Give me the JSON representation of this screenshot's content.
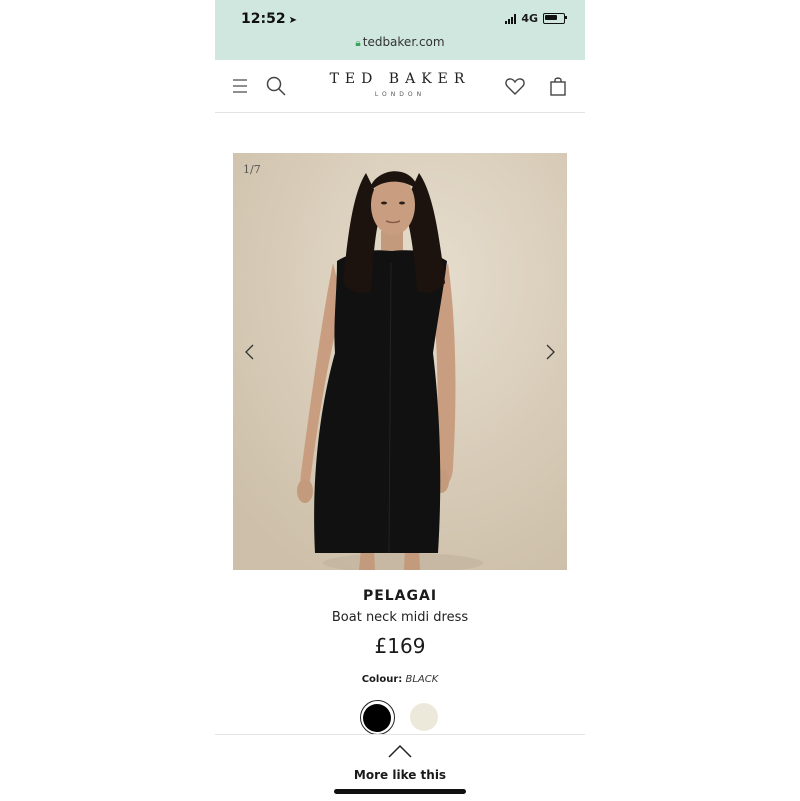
{
  "status_bar": {
    "time": "12:52",
    "network": "4G"
  },
  "browser": {
    "url": "tedbaker.com"
  },
  "header": {
    "brand_name": "TED BAKER",
    "brand_sub": "LONDON",
    "icons": [
      "menu-icon",
      "search-icon",
      "heart-icon",
      "bag-icon"
    ]
  },
  "gallery": {
    "counter": "1/7"
  },
  "product": {
    "name": "PELAGAI",
    "description": "Boat neck midi dress",
    "price": "£169",
    "colour_label": "Colour:",
    "colour_value": "BLACK",
    "swatches": [
      {
        "name": "black",
        "color": "#000000",
        "selected": true
      },
      {
        "name": "cream",
        "color": "#ede9da",
        "selected": false
      }
    ]
  },
  "footer": {
    "more_like_this": "More like this"
  },
  "colors": {
    "status_bar_bg": "#cfe7df",
    "image_bg": "#d8cdbb",
    "dress": "#111111"
  }
}
